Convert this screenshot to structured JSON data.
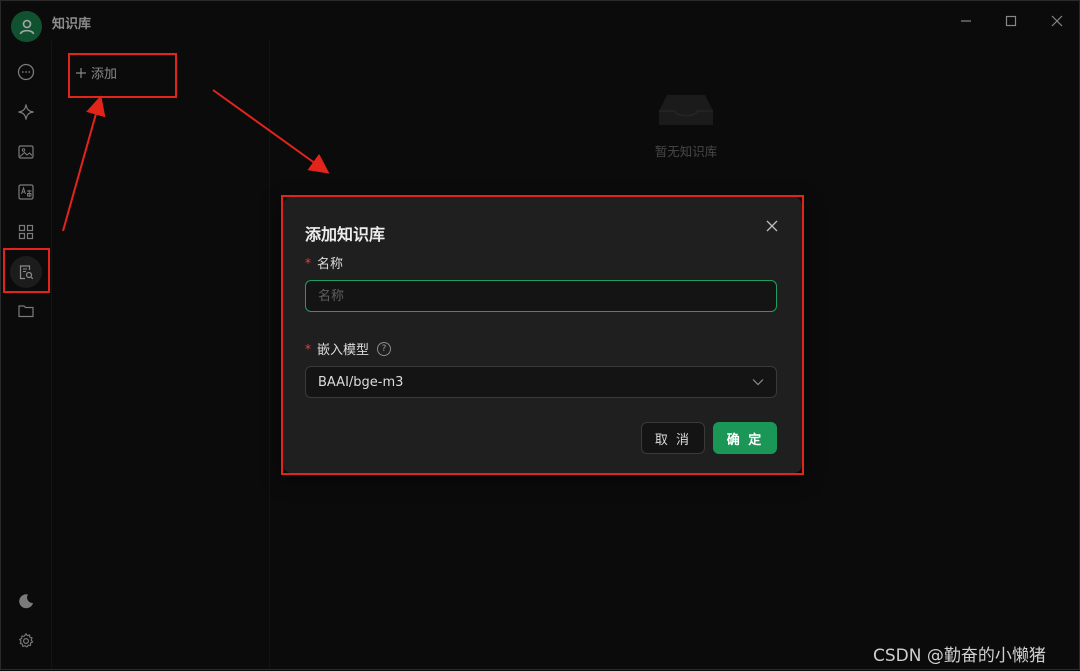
{
  "window": {
    "title": "知识库"
  },
  "rail": {
    "items": [
      {
        "icon": "chat-bubble-icon"
      },
      {
        "icon": "sparkle-icon"
      },
      {
        "icon": "image-icon"
      },
      {
        "icon": "translate-icon"
      },
      {
        "icon": "apps-grid-icon"
      },
      {
        "icon": "knowledge-base-icon",
        "active": true
      },
      {
        "icon": "folder-icon"
      }
    ],
    "bottom": [
      {
        "icon": "moon-icon"
      },
      {
        "icon": "gear-icon"
      }
    ]
  },
  "list_panel": {
    "add_label": "添加"
  },
  "main": {
    "empty_text": "暂无知识库"
  },
  "modal": {
    "title": "添加知识库",
    "name_label": "名称",
    "name_placeholder": "名称",
    "name_value": "",
    "model_label": "嵌入模型",
    "model_value": "BAAI/bge-m3",
    "cancel_label": "取 消",
    "ok_label": "确 定"
  },
  "colors": {
    "accent": "#1a9656",
    "focus_border": "#1f9e5f",
    "annotation": "#e3241b",
    "required": "#e0443e"
  },
  "watermark": "CSDN @勤奋的小懒猪"
}
